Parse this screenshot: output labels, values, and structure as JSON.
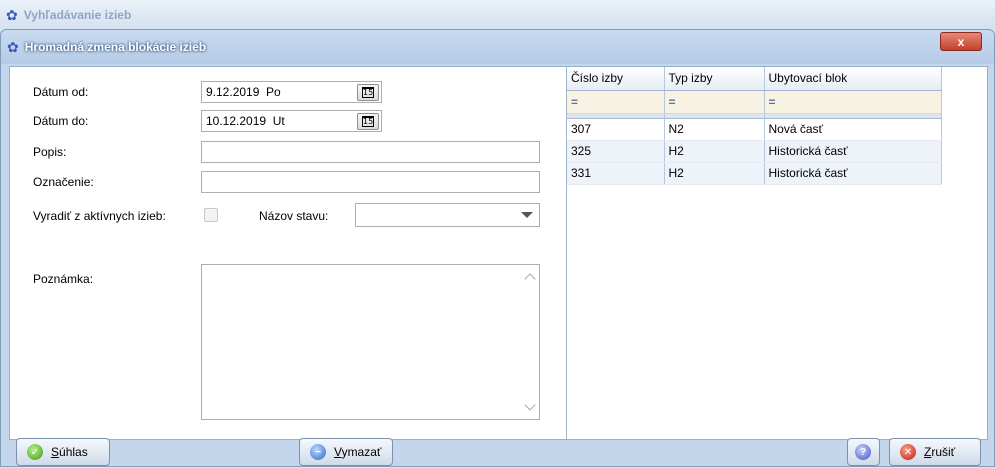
{
  "parent_window": {
    "title": "Vyhľadávanie izieb"
  },
  "dialog": {
    "title": "Hromadná zmena blokácie izieb",
    "close_label": "x"
  },
  "form": {
    "date_from_label": "Dátum od:",
    "date_from_value": "9.12.2019  Po",
    "date_to_label": "Dátum do:",
    "date_to_value": "10.12.2019  Ut",
    "description_label": "Popis:",
    "description_value": "",
    "designation_label": "Označenie:",
    "designation_value": "",
    "exclude_label": "Vyradiť z aktívnych izieb:",
    "exclude_checked": false,
    "state_name_label": "Názov stavu:",
    "state_name_value": "",
    "note_label": "Poznámka:",
    "note_value": "",
    "calendar_glyph": "15"
  },
  "grid": {
    "columns": [
      "Číslo izby",
      "Typ izby",
      "Ubytovací blok"
    ],
    "filter_symbol": "=",
    "rows": [
      [
        "307",
        "N2",
        "Nová časť"
      ],
      [
        "325",
        "H2",
        "Historická časť"
      ],
      [
        "331",
        "H2",
        "Historická časť"
      ]
    ]
  },
  "buttons": {
    "ok_first": "S",
    "ok_rest": "úhlas",
    "clear_first": "V",
    "clear_rest": "ymazať",
    "cancel_first": "Z",
    "cancel_rest": "rušiť"
  },
  "icons": {
    "app": "flower-icon",
    "ok": "check-icon",
    "clear": "minus-icon",
    "help": "help-icon",
    "cancel": "cancel-icon"
  },
  "colors": {
    "title_bar": "#b5cbe6",
    "close_button": "#c4402a",
    "filter_row": "#f8f2e2"
  }
}
